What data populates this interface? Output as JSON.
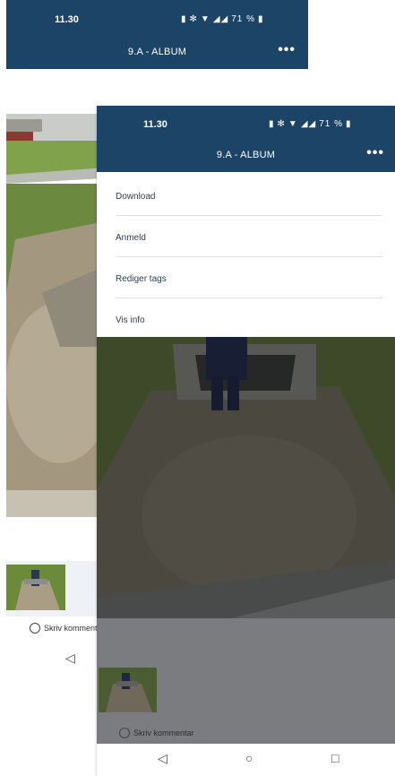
{
  "back_screen": {
    "status": {
      "time": "11.30",
      "battery": "71 %"
    },
    "title": "9.A - ALBUM",
    "more_icon": "more-horizontal-icon",
    "comment_placeholder": "Skriv kommentar",
    "nav_back_glyph": "◁"
  },
  "front_screen": {
    "status": {
      "time": "11.30",
      "battery": "71 %"
    },
    "title": "9.A - ALBUM",
    "more_icon": "more-horizontal-icon",
    "menu": [
      {
        "label": "Download"
      },
      {
        "label": "Anmeld"
      },
      {
        "label": "Rediger tags"
      },
      {
        "label": "Vis info"
      }
    ],
    "comment_placeholder": "Skriv kommentar",
    "nav": {
      "back": "◁",
      "home": "○",
      "recents": "□"
    }
  },
  "colors": {
    "app_bar": "#1c4466",
    "menu_text": "#2d3e50",
    "dim_overlay": "#7a7c7f"
  }
}
